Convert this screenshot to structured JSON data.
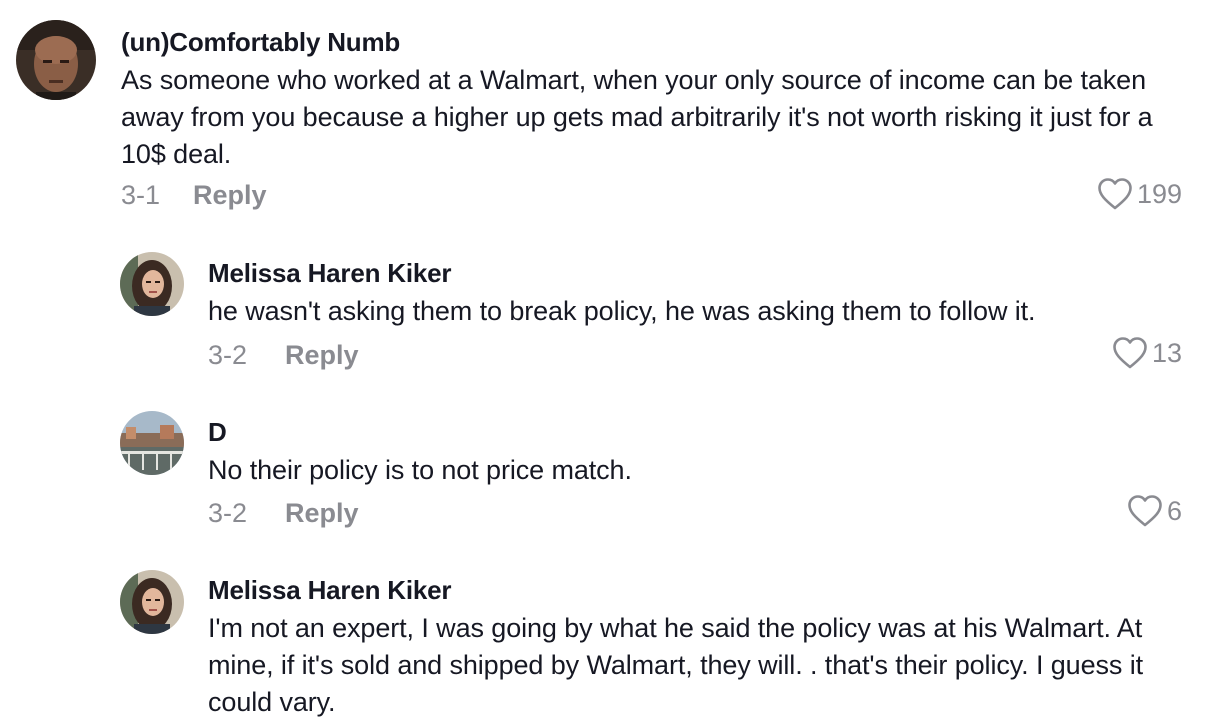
{
  "comments": [
    {
      "username": "(un)Comfortably Numb",
      "text": "As someone who worked at a Walmart, when your only source of income can be taken away from you because a higher up gets mad arbitrarily it's not worth risking it just for a 10$ deal.",
      "date": "3-1",
      "reply_label": "Reply",
      "likes": "199",
      "avatar_icon": "man-face-avatar"
    },
    {
      "username": "Melissa Haren Kiker",
      "text": "he wasn't asking them to break policy, he was asking them to follow it.",
      "date": "3-2",
      "reply_label": "Reply",
      "likes": "13",
      "avatar_icon": "woman-face-avatar"
    },
    {
      "username": "D",
      "text": "No their policy is to not price match.",
      "date": "3-2",
      "reply_label": "Reply",
      "likes": "6",
      "avatar_icon": "landscape-avatar"
    },
    {
      "username": "Melissa Haren Kiker",
      "text": "I'm not an expert, I was going by what he said the policy was at his Walmart. At mine, if it's sold and shipped by Walmart, they will. . that's their policy. I guess it could vary.",
      "avatar_icon": "woman-face-avatar"
    }
  ],
  "colors": {
    "text": "#161823",
    "muted": "#8a8b91",
    "background": "#ffffff"
  }
}
